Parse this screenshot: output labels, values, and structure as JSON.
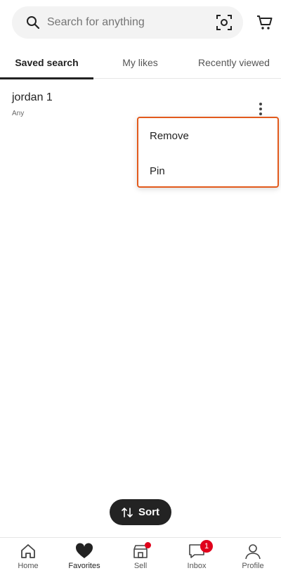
{
  "search": {
    "placeholder": "Search for anything"
  },
  "tabs": [
    {
      "label": "Saved search",
      "active": true
    },
    {
      "label": "My likes",
      "active": false
    },
    {
      "label": "Recently viewed",
      "active": false
    }
  ],
  "saved_search": {
    "title": "jordan 1",
    "subtitle": "Any"
  },
  "menu": {
    "items": [
      {
        "label": "Remove"
      },
      {
        "label": "Pin"
      }
    ],
    "border_color": "#e25a1c"
  },
  "sort": {
    "label": "Sort"
  },
  "bottom_nav": {
    "items": [
      {
        "label": "Home",
        "icon": "home-icon"
      },
      {
        "label": "Favorites",
        "icon": "heart-icon",
        "active": true
      },
      {
        "label": "Sell",
        "icon": "store-icon"
      },
      {
        "label": "Inbox",
        "icon": "chat-icon",
        "badge": "1"
      },
      {
        "label": "Profile",
        "icon": "person-icon"
      }
    ]
  },
  "colors": {
    "badge": "#e0001b",
    "sort_bg": "#232323"
  }
}
